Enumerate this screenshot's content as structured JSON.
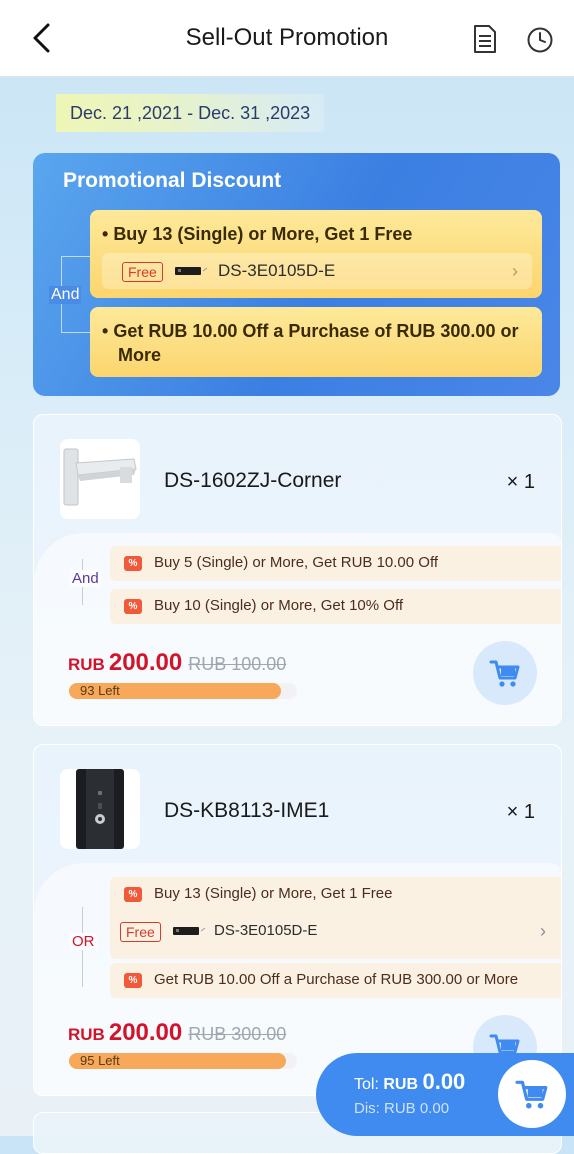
{
  "header": {
    "title": "Sell-Out Promotion",
    "icons": [
      "back-chevron-icon",
      "document-icon",
      "clock-icon"
    ]
  },
  "date_range": "Dec. 21 ,2021 - Dec. 31 ,2023",
  "promotion": {
    "title": "Promotional Discount",
    "connector": "And",
    "rules": [
      {
        "text": "Buy 13 (Single) or More, Get 1 Free",
        "gift": {
          "tag": "Free",
          "code": "DS-3E0105D-E"
        }
      },
      {
        "text": "Get RUB 10.00 Off a Purchase of RUB 300.00 or More"
      }
    ]
  },
  "products": [
    {
      "name": "DS-1602ZJ-Corner",
      "qty": "× 1",
      "connector": "And",
      "rules": [
        "Buy 5 (Single) or More, Get RUB 10.00 Off",
        "Buy 10 (Single) or More, Get 10% Off"
      ],
      "currency": "RUB",
      "price": "200.00",
      "old_price": "RUB 100.00",
      "stock_text": "93 Left",
      "stock_fraction": 0.93
    },
    {
      "name": "DS-KB8113-IME1",
      "qty": "× 1",
      "connector": "OR",
      "rules": [
        "Buy 13 (Single) or More, Get 1 Free",
        "Get RUB 10.00 Off a Purchase of RUB 300.00 or More"
      ],
      "gift": {
        "tag": "Free",
        "code": "DS-3E0105D-E"
      },
      "currency": "RUB",
      "price": "200.00",
      "old_price": "RUB 300.00",
      "stock_text": "95 Left",
      "stock_fraction": 0.95
    }
  ],
  "cart_summary": {
    "tol_label": "Tol: ",
    "tol_currency": "RUB",
    "tol_value": "0.00",
    "dis_text": "Dis: RUB 0.00"
  },
  "colors": {
    "accent_blue": "#3f8bef",
    "price_red": "#d1142c",
    "stock_orange": "#f7a85a"
  }
}
